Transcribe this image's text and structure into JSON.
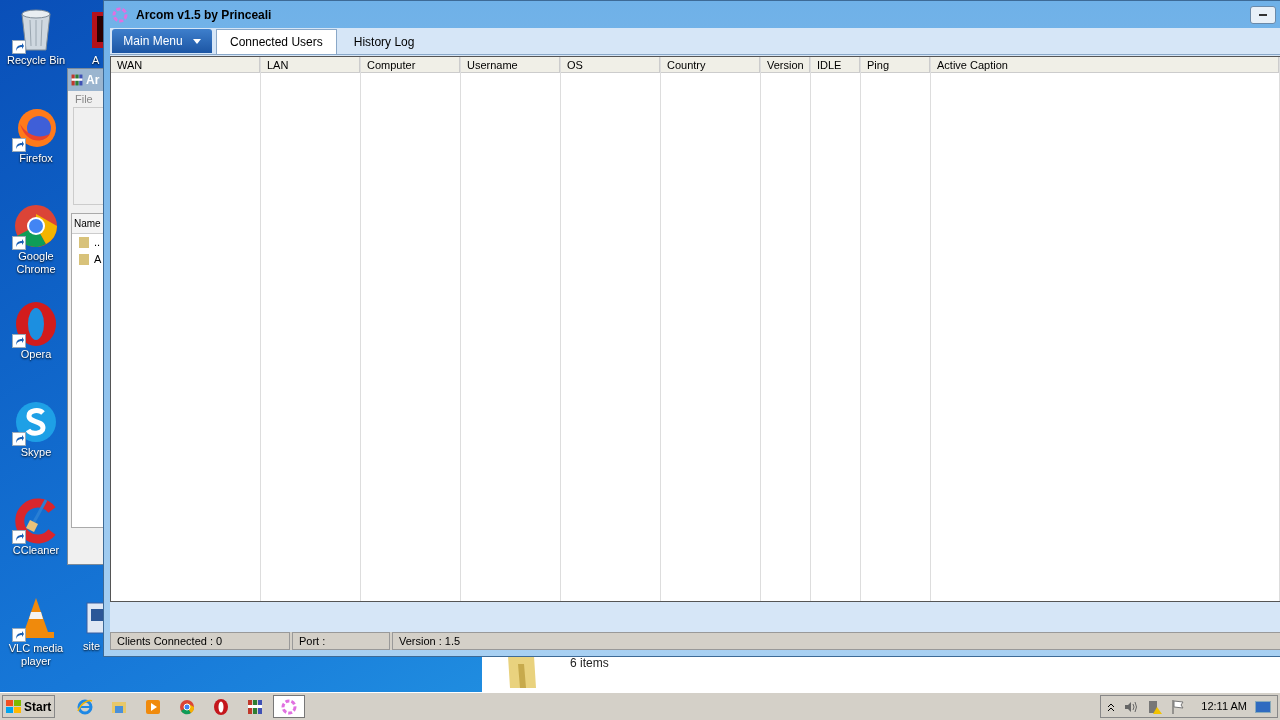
{
  "desktop": {
    "icons": [
      {
        "label": "Recycle Bin",
        "kind": "trash"
      },
      {
        "label": "Firefox",
        "kind": "firefox"
      },
      {
        "label": "Google Chrome",
        "kind": "chrome"
      },
      {
        "label": "Opera",
        "kind": "opera"
      },
      {
        "label": "Skype",
        "kind": "skype"
      },
      {
        "label": "CCleaner",
        "kind": "ccleaner"
      },
      {
        "label": "VLC media player",
        "kind": "vlc"
      }
    ],
    "partial_icons": [
      {
        "label": "A",
        "kind": "app"
      },
      {
        "label": "site",
        "kind": "doc"
      }
    ]
  },
  "background_window": {
    "title": "Ar",
    "menu": [
      "File"
    ],
    "column": "Name",
    "rows": [
      "..",
      "A"
    ]
  },
  "explorer_window": {
    "status": "6 items"
  },
  "window": {
    "title": "Arcom v1.5 by Princeali",
    "main_menu": "Main Menu",
    "tabs": [
      {
        "label": "Connected Users",
        "selected": true
      },
      {
        "label": "History Log",
        "selected": false
      }
    ],
    "table": {
      "columns": [
        "WAN",
        "LAN",
        "Computer",
        "Username",
        "OS",
        "Country",
        "Version",
        "IDLE",
        "Ping",
        "Active Caption"
      ]
    },
    "status_bar": [
      "Clients Connected : 0",
      "Port :",
      "Version : 1.5"
    ]
  },
  "taskbar": {
    "start": "Start",
    "items": [
      {
        "kind": "ie",
        "selected": false
      },
      {
        "kind": "explorer",
        "selected": false
      },
      {
        "kind": "media",
        "selected": false
      },
      {
        "kind": "chrome",
        "selected": false
      },
      {
        "kind": "opera",
        "selected": false
      },
      {
        "kind": "winrar",
        "selected": false
      },
      {
        "kind": "arcom",
        "selected": true
      }
    ],
    "clock": "12:11 AM"
  }
}
